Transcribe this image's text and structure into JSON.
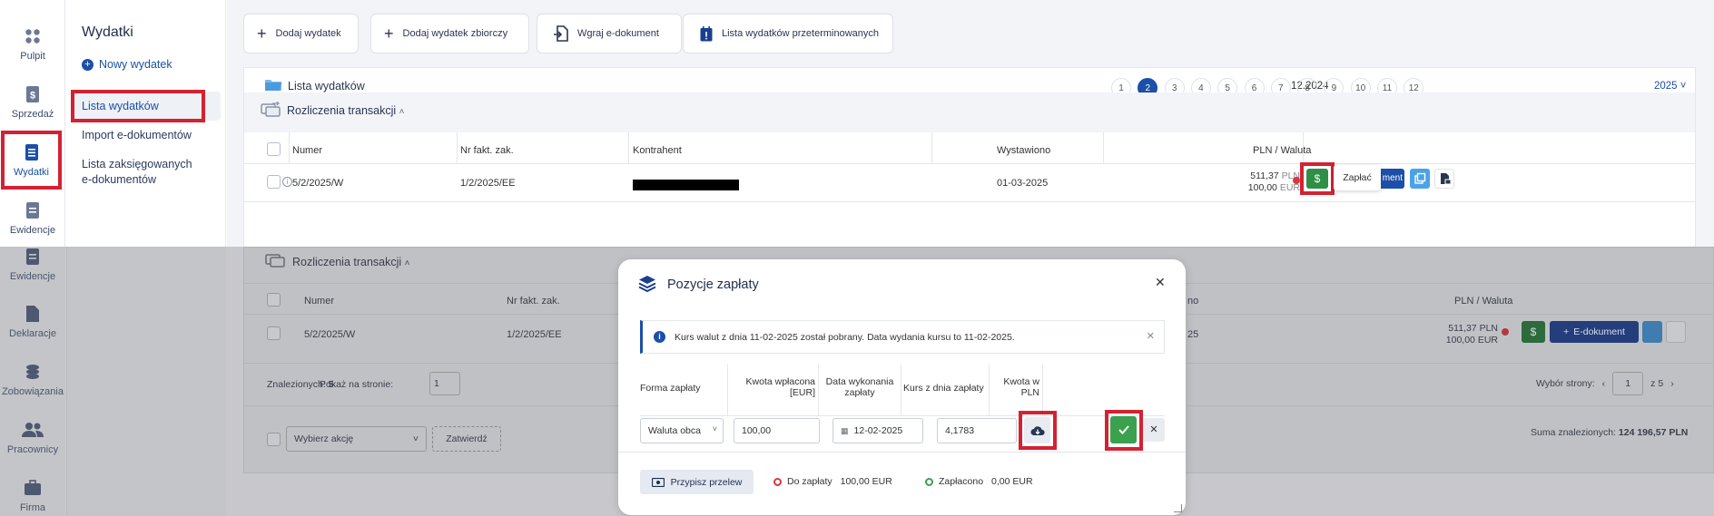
{
  "rail": [
    {
      "label": "Pulpit",
      "icon": "grid-icon"
    },
    {
      "label": "Sprzedaż",
      "icon": "dollar-doc-icon"
    },
    {
      "label": "Wydatki",
      "icon": "receipt-icon"
    },
    {
      "label": "Ewidencje",
      "icon": "list-doc-icon"
    }
  ],
  "rail_overlay": [
    {
      "label": "Ewidencje",
      "icon": "list-doc-icon"
    },
    {
      "label": "Deklaracje",
      "icon": "document-icon"
    },
    {
      "label": "Zobowiązania",
      "icon": "coins-icon"
    },
    {
      "label": "Pracownicy",
      "icon": "people-icon"
    },
    {
      "label": "Firma",
      "icon": "briefcase-icon"
    }
  ],
  "submenu": {
    "title": "Wydatki",
    "new": "Nowy wydatek",
    "items": [
      "Lista wydatków",
      "Import e-dokumentów",
      "Lista zaksięgowanych",
      "e-dokumentów"
    ]
  },
  "toolbar": {
    "add": "Dodaj wydatek",
    "add_bulk": "Dodaj wydatek zbiorczy",
    "upload": "Wgraj e-dokument",
    "overdue": "Lista wydatków przeterminowanych"
  },
  "list": {
    "title": "Lista wydatków",
    "period": "12.2024",
    "months": [
      "1",
      "2",
      "3",
      "4",
      "5",
      "6",
      "7",
      "8",
      "9",
      "10",
      "11",
      "12"
    ],
    "active_month": "2",
    "year": "2025 ˅",
    "section": "Rozliczenia transakcji"
  },
  "table": {
    "headers": {
      "number": "Numer",
      "invoice": "Nr fakt. zak.",
      "contractor": "Kontrahent",
      "issued": "Wystawiono",
      "amount": "PLN / Waluta"
    },
    "row": {
      "number": "5/2/2025/W",
      "invoice": "1/2/2025/EE",
      "issued": "01-03-2025",
      "pln": "511,37",
      "pln_cur": "PLN",
      "eur": "100,00",
      "eur_cur": "EUR"
    },
    "pay_tooltip": "Zapłać",
    "edoc_fragment": "ment",
    "edoc": "E-dokument"
  },
  "bg": {
    "section": "Rozliczenia transakcji",
    "headers": {
      "number": "Numer",
      "invoice": "Nr fakt. zak.",
      "issued_fragment": "no",
      "amount": "PLN / Waluta"
    },
    "row": {
      "number": "5/2/2025/W",
      "invoice": "1/2/2025/EE",
      "issued_fragment": "25",
      "pln": "511,37",
      "pln_cur": "PLN",
      "eur": "100,00",
      "eur_cur": "EUR"
    },
    "found_label": "Znalezionych:",
    "found_count": "5",
    "per_page_label": "Pokaż na stronie:",
    "per_page": "1",
    "page_select_label": "Wybór strony:",
    "page_current": "1",
    "page_of": "z 5",
    "action_placeholder": "Wybierz akcję",
    "confirm": "Zatwierdź",
    "sum_label": "Suma znalezionych:",
    "sum_value": "124 196,57 PLN"
  },
  "modal": {
    "title": "Pozycje zapłaty",
    "alert": "Kurs walut z dnia 11-02-2025 został pobrany. Data wydania kursu to 11-02-2025.",
    "columns": {
      "form": "Forma zapłaty",
      "amount_l1": "Kwota wpłacona",
      "amount_l2": "[EUR]",
      "date_l1": "Data wykonania",
      "date_l2": "zapłaty",
      "rate": "Kurs z dnia zapłaty",
      "pln_l1": "Kwota w",
      "pln_l2": "PLN"
    },
    "form_value": "Waluta obca",
    "amount_value": "100,00",
    "date_value": "12-02-2025",
    "rate_value": "4,1783",
    "assign_transfer": "Przypisz przelew",
    "to_pay_label": "Do zapłaty",
    "to_pay_value": "100,00 EUR",
    "paid_label": "Zapłacono",
    "paid_value": "0,00 EUR"
  },
  "colors": {
    "accent": "#1b4fa8",
    "highlight": "#d32232",
    "success": "#2f8f46",
    "light_blue": "#4aa3e8"
  }
}
